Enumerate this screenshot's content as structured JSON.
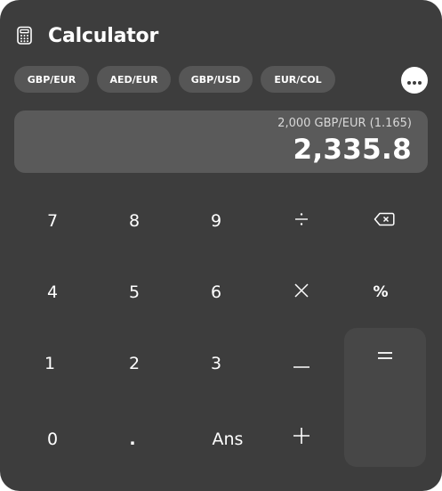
{
  "app": {
    "title": "Calculator",
    "icon": "calculator-icon"
  },
  "pairs": [
    {
      "label": "GBP/EUR"
    },
    {
      "label": "AED/EUR"
    },
    {
      "label": "GBP/USD"
    },
    {
      "label": "EUR/COL"
    }
  ],
  "more_icon": "more-horizontal-icon",
  "display": {
    "expression": "2,000 GBP/EUR  (1.165)",
    "result": "2,335.8"
  },
  "keys": {
    "seven": "7",
    "eight": "8",
    "nine": "9",
    "four": "4",
    "five": "5",
    "six": "6",
    "one": "1",
    "two": "2",
    "three": "3",
    "zero": "0",
    "decimal": ".",
    "ans": "Ans",
    "percent": "%"
  },
  "icons": {
    "divide": "divide-icon",
    "backspace": "backspace-icon",
    "multiply": "multiply-icon",
    "minus": "minus-icon",
    "plus": "plus-icon",
    "equals": "equals-icon"
  },
  "colors": {
    "window_bg": "#3d3d3d",
    "chip_bg": "#565656",
    "display_bg": "#5a5a5a",
    "equals_bg": "#474747",
    "text": "#ffffff"
  }
}
